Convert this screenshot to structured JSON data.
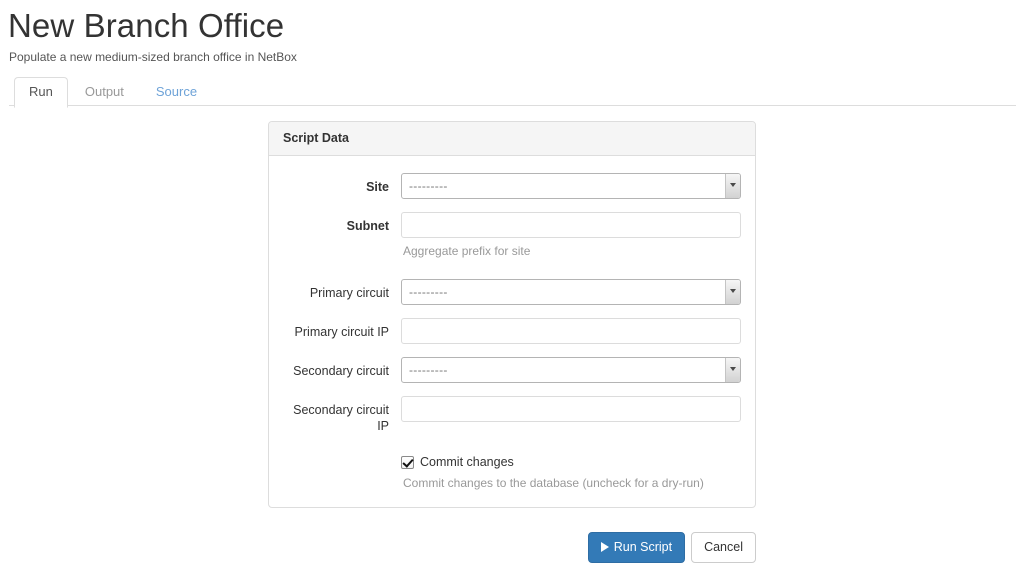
{
  "header": {
    "title": "New Branch Office",
    "subtitle": "Populate a new medium-sized branch office in NetBox"
  },
  "tabs": [
    {
      "label": "Run",
      "state": "active"
    },
    {
      "label": "Output",
      "state": "muted"
    },
    {
      "label": "Source",
      "state": "link"
    }
  ],
  "panel": {
    "title": "Script Data",
    "fields": [
      {
        "label": "Site",
        "type": "select",
        "value": "---------",
        "required": true,
        "help": ""
      },
      {
        "label": "Subnet",
        "type": "text",
        "value": "",
        "placeholder": "",
        "required": true,
        "help": "Aggregate prefix for site"
      },
      {
        "label": "Primary circuit",
        "type": "select",
        "value": "---------",
        "required": false,
        "help": ""
      },
      {
        "label": "Primary circuit IP",
        "type": "text",
        "value": "",
        "placeholder": "",
        "required": false,
        "help": ""
      },
      {
        "label": "Secondary circuit",
        "type": "select",
        "value": "---------",
        "required": false,
        "help": ""
      },
      {
        "label": "Secondary circuit IP",
        "type": "text",
        "value": "",
        "placeholder": "",
        "required": false,
        "help": ""
      }
    ],
    "commit": {
      "label": "Commit changes",
      "checked": true,
      "help": "Commit changes to the database (uncheck for a dry-run)"
    }
  },
  "actions": {
    "run_label": "Run Script",
    "cancel_label": "Cancel",
    "run_icon": "play-icon"
  },
  "colors": {
    "primary": "#337ab7",
    "primary_border": "#2e6da4",
    "link": "#6ea3d8",
    "panel_heading_bg": "#f5f5f5",
    "border": "#dddddd",
    "muted_text": "#999999"
  }
}
